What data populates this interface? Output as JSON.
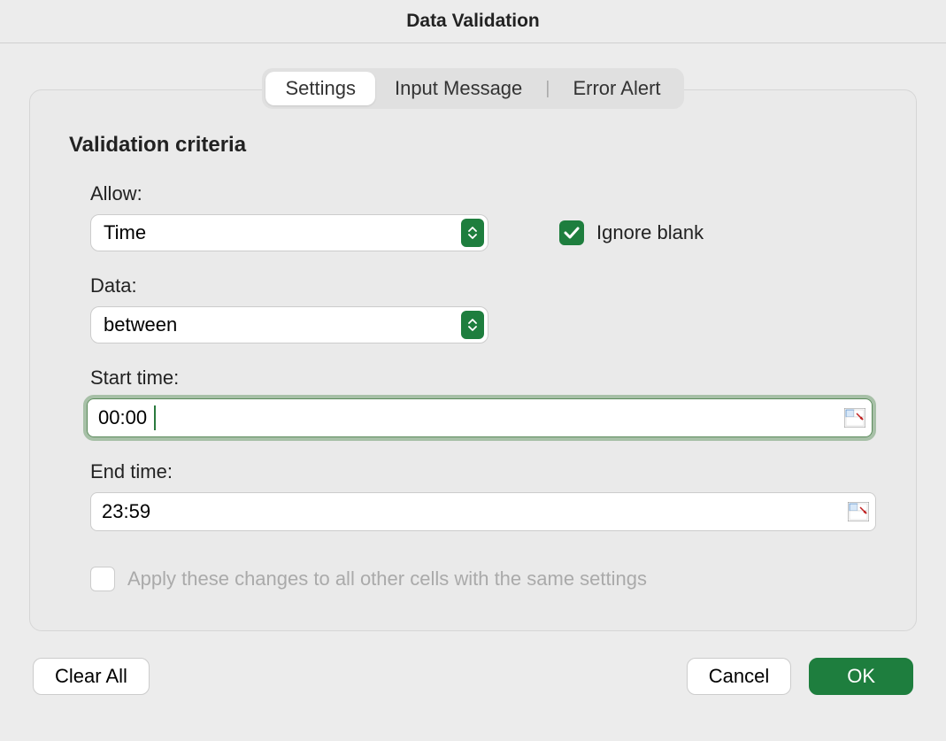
{
  "title": "Data Validation",
  "tabs": {
    "settings": "Settings",
    "input_message": "Input Message",
    "error_alert": "Error Alert"
  },
  "section_title": "Validation criteria",
  "allow": {
    "label": "Allow:",
    "value": "Time"
  },
  "ignore_blank": {
    "label": "Ignore blank",
    "checked": true
  },
  "data": {
    "label": "Data:",
    "value": "between"
  },
  "start_time": {
    "label": "Start time:",
    "value": "00:00"
  },
  "end_time": {
    "label": "End time:",
    "value": "23:59"
  },
  "apply_all": {
    "label": "Apply these changes to all other cells with the same settings",
    "checked": false
  },
  "buttons": {
    "clear_all": "Clear All",
    "cancel": "Cancel",
    "ok": "OK"
  }
}
